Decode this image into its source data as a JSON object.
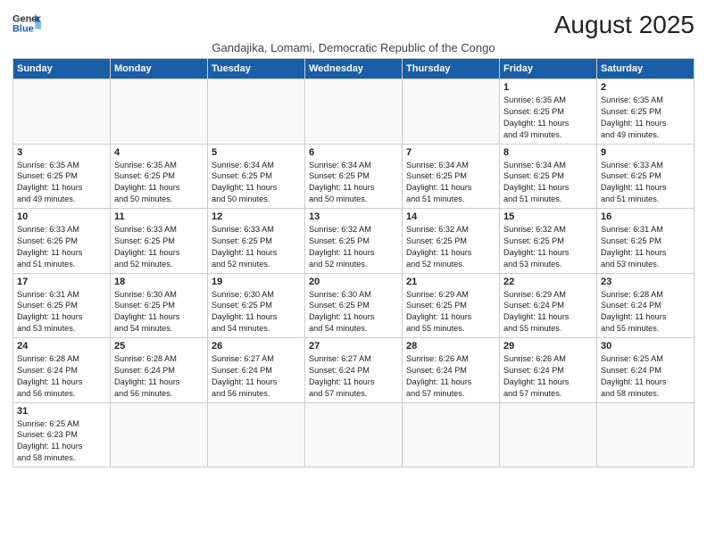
{
  "logo": {
    "line1": "General",
    "line2": "Blue"
  },
  "title": "August 2025",
  "subtitle": "Gandajika, Lomami, Democratic Republic of the Congo",
  "weekdays": [
    "Sunday",
    "Monday",
    "Tuesday",
    "Wednesday",
    "Thursday",
    "Friday",
    "Saturday"
  ],
  "weeks": [
    [
      {
        "day": "",
        "info": ""
      },
      {
        "day": "",
        "info": ""
      },
      {
        "day": "",
        "info": ""
      },
      {
        "day": "",
        "info": ""
      },
      {
        "day": "",
        "info": ""
      },
      {
        "day": "1",
        "info": "Sunrise: 6:35 AM\nSunset: 6:25 PM\nDaylight: 11 hours\nand 49 minutes."
      },
      {
        "day": "2",
        "info": "Sunrise: 6:35 AM\nSunset: 6:25 PM\nDaylight: 11 hours\nand 49 minutes."
      }
    ],
    [
      {
        "day": "3",
        "info": "Sunrise: 6:35 AM\nSunset: 6:25 PM\nDaylight: 11 hours\nand 49 minutes."
      },
      {
        "day": "4",
        "info": "Sunrise: 6:35 AM\nSunset: 6:25 PM\nDaylight: 11 hours\nand 50 minutes."
      },
      {
        "day": "5",
        "info": "Sunrise: 6:34 AM\nSunset: 6:25 PM\nDaylight: 11 hours\nand 50 minutes."
      },
      {
        "day": "6",
        "info": "Sunrise: 6:34 AM\nSunset: 6:25 PM\nDaylight: 11 hours\nand 50 minutes."
      },
      {
        "day": "7",
        "info": "Sunrise: 6:34 AM\nSunset: 6:25 PM\nDaylight: 11 hours\nand 51 minutes."
      },
      {
        "day": "8",
        "info": "Sunrise: 6:34 AM\nSunset: 6:25 PM\nDaylight: 11 hours\nand 51 minutes."
      },
      {
        "day": "9",
        "info": "Sunrise: 6:33 AM\nSunset: 6:25 PM\nDaylight: 11 hours\nand 51 minutes."
      }
    ],
    [
      {
        "day": "10",
        "info": "Sunrise: 6:33 AM\nSunset: 6:25 PM\nDaylight: 11 hours\nand 51 minutes."
      },
      {
        "day": "11",
        "info": "Sunrise: 6:33 AM\nSunset: 6:25 PM\nDaylight: 11 hours\nand 52 minutes."
      },
      {
        "day": "12",
        "info": "Sunrise: 6:33 AM\nSunset: 6:25 PM\nDaylight: 11 hours\nand 52 minutes."
      },
      {
        "day": "13",
        "info": "Sunrise: 6:32 AM\nSunset: 6:25 PM\nDaylight: 11 hours\nand 52 minutes."
      },
      {
        "day": "14",
        "info": "Sunrise: 6:32 AM\nSunset: 6:25 PM\nDaylight: 11 hours\nand 52 minutes."
      },
      {
        "day": "15",
        "info": "Sunrise: 6:32 AM\nSunset: 6:25 PM\nDaylight: 11 hours\nand 53 minutes."
      },
      {
        "day": "16",
        "info": "Sunrise: 6:31 AM\nSunset: 6:25 PM\nDaylight: 11 hours\nand 53 minutes."
      }
    ],
    [
      {
        "day": "17",
        "info": "Sunrise: 6:31 AM\nSunset: 6:25 PM\nDaylight: 11 hours\nand 53 minutes."
      },
      {
        "day": "18",
        "info": "Sunrise: 6:30 AM\nSunset: 6:25 PM\nDaylight: 11 hours\nand 54 minutes."
      },
      {
        "day": "19",
        "info": "Sunrise: 6:30 AM\nSunset: 6:25 PM\nDaylight: 11 hours\nand 54 minutes."
      },
      {
        "day": "20",
        "info": "Sunrise: 6:30 AM\nSunset: 6:25 PM\nDaylight: 11 hours\nand 54 minutes."
      },
      {
        "day": "21",
        "info": "Sunrise: 6:29 AM\nSunset: 6:25 PM\nDaylight: 11 hours\nand 55 minutes."
      },
      {
        "day": "22",
        "info": "Sunrise: 6:29 AM\nSunset: 6:24 PM\nDaylight: 11 hours\nand 55 minutes."
      },
      {
        "day": "23",
        "info": "Sunrise: 6:28 AM\nSunset: 6:24 PM\nDaylight: 11 hours\nand 55 minutes."
      }
    ],
    [
      {
        "day": "24",
        "info": "Sunrise: 6:28 AM\nSunset: 6:24 PM\nDaylight: 11 hours\nand 56 minutes."
      },
      {
        "day": "25",
        "info": "Sunrise: 6:28 AM\nSunset: 6:24 PM\nDaylight: 11 hours\nand 56 minutes."
      },
      {
        "day": "26",
        "info": "Sunrise: 6:27 AM\nSunset: 6:24 PM\nDaylight: 11 hours\nand 56 minutes."
      },
      {
        "day": "27",
        "info": "Sunrise: 6:27 AM\nSunset: 6:24 PM\nDaylight: 11 hours\nand 57 minutes."
      },
      {
        "day": "28",
        "info": "Sunrise: 6:26 AM\nSunset: 6:24 PM\nDaylight: 11 hours\nand 57 minutes."
      },
      {
        "day": "29",
        "info": "Sunrise: 6:26 AM\nSunset: 6:24 PM\nDaylight: 11 hours\nand 57 minutes."
      },
      {
        "day": "30",
        "info": "Sunrise: 6:25 AM\nSunset: 6:24 PM\nDaylight: 11 hours\nand 58 minutes."
      }
    ],
    [
      {
        "day": "31",
        "info": "Sunrise: 6:25 AM\nSunset: 6:23 PM\nDaylight: 11 hours\nand 58 minutes."
      },
      {
        "day": "",
        "info": ""
      },
      {
        "day": "",
        "info": ""
      },
      {
        "day": "",
        "info": ""
      },
      {
        "day": "",
        "info": ""
      },
      {
        "day": "",
        "info": ""
      },
      {
        "day": "",
        "info": ""
      }
    ]
  ]
}
